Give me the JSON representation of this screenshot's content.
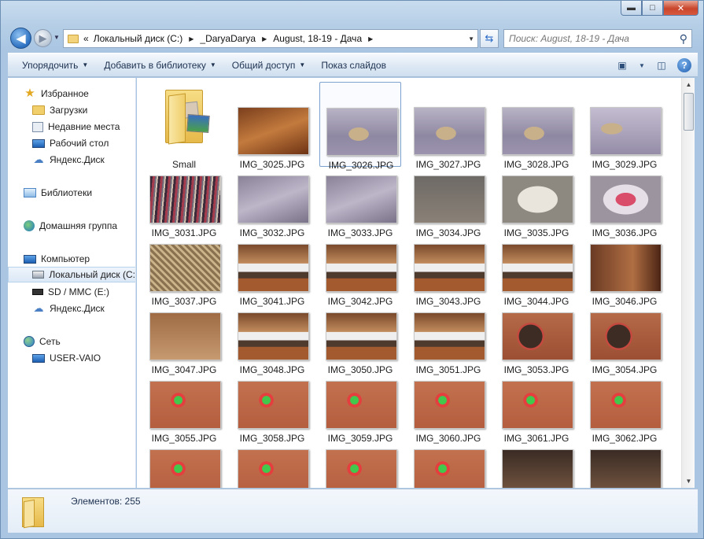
{
  "window": {
    "caption_buttons": {
      "minimize": "▬",
      "maximize": "□",
      "close": "✕"
    }
  },
  "address": {
    "prefix": "«",
    "crumbs": [
      "Локальный диск (C:)",
      "_DaryaDarya",
      "August, 18-19 - Дача"
    ]
  },
  "search": {
    "placeholder": "Поиск: August, 18-19 - Дача"
  },
  "toolbar": {
    "organize": "Упорядочить",
    "add_to_library": "Добавить в библиотеку",
    "share": "Общий доступ",
    "slideshow": "Показ слайдов"
  },
  "sidebar": {
    "favorites": "Избранное",
    "downloads": "Загрузки",
    "recent": "Недавние места",
    "desktop": "Рабочий стол",
    "yandex1": "Яндекс.Диск",
    "libraries": "Библиотеки",
    "homegroup": "Домашняя группа",
    "computer": "Компьютер",
    "local_disk": "Локальный диск (C:",
    "sd": "SD / MMC (E:)",
    "yandex2": "Яндекс.Диск",
    "network": "Сеть",
    "user_vaio": "USER-VAIO"
  },
  "files": [
    {
      "name": "Small",
      "kind": "folder"
    },
    {
      "name": "IMG_3025.JPG",
      "kind": "wood"
    },
    {
      "name": "IMG_3026.JPG",
      "kind": "cat",
      "selected": true
    },
    {
      "name": "IMG_3027.JPG",
      "kind": "cat"
    },
    {
      "name": "IMG_3028.JPG",
      "kind": "cat"
    },
    {
      "name": "IMG_3029.JPG",
      "kind": "cat2"
    },
    {
      "name": "IMG_3031.JPG",
      "kind": "vinyl"
    },
    {
      "name": "IMG_3032.JPG",
      "kind": "tools"
    },
    {
      "name": "IMG_3033.JPG",
      "kind": "tools"
    },
    {
      "name": "IMG_3034.JPG",
      "kind": "frames"
    },
    {
      "name": "IMG_3035.JPG",
      "kind": "frame1"
    },
    {
      "name": "IMG_3036.JPG",
      "kind": "frame2"
    },
    {
      "name": "IMG_3037.JPG",
      "kind": "weave"
    },
    {
      "name": "IMG_3041.JPG",
      "kind": "bed"
    },
    {
      "name": "IMG_3042.JPG",
      "kind": "bed"
    },
    {
      "name": "IMG_3043.JPG",
      "kind": "bed"
    },
    {
      "name": "IMG_3044.JPG",
      "kind": "bed"
    },
    {
      "name": "IMG_3046.JPG",
      "kind": "wall"
    },
    {
      "name": "IMG_3047.JPG",
      "kind": "rug"
    },
    {
      "name": "IMG_3048.JPG",
      "kind": "bed"
    },
    {
      "name": "IMG_3050.JPG",
      "kind": "bed"
    },
    {
      "name": "IMG_3051.JPG",
      "kind": "bed"
    },
    {
      "name": "IMG_3053.JPG",
      "kind": "basket"
    },
    {
      "name": "IMG_3054.JPG",
      "kind": "basket"
    },
    {
      "name": "IMG_3055.JPG",
      "kind": "slinky"
    },
    {
      "name": "IMG_3058.JPG",
      "kind": "slinky"
    },
    {
      "name": "IMG_3059.JPG",
      "kind": "slinky"
    },
    {
      "name": "IMG_3060.JPG",
      "kind": "slinky"
    },
    {
      "name": "IMG_3061.JPG",
      "kind": "slinky"
    },
    {
      "name": "IMG_3062.JPG",
      "kind": "slinky"
    },
    {
      "name": "",
      "kind": "slinky"
    },
    {
      "name": "",
      "kind": "slinky"
    },
    {
      "name": "",
      "kind": "slinky"
    },
    {
      "name": "",
      "kind": "slinky"
    },
    {
      "name": "",
      "kind": "dark"
    },
    {
      "name": "",
      "kind": "dark"
    }
  ],
  "details": {
    "count_text": "Элементов: 255"
  }
}
